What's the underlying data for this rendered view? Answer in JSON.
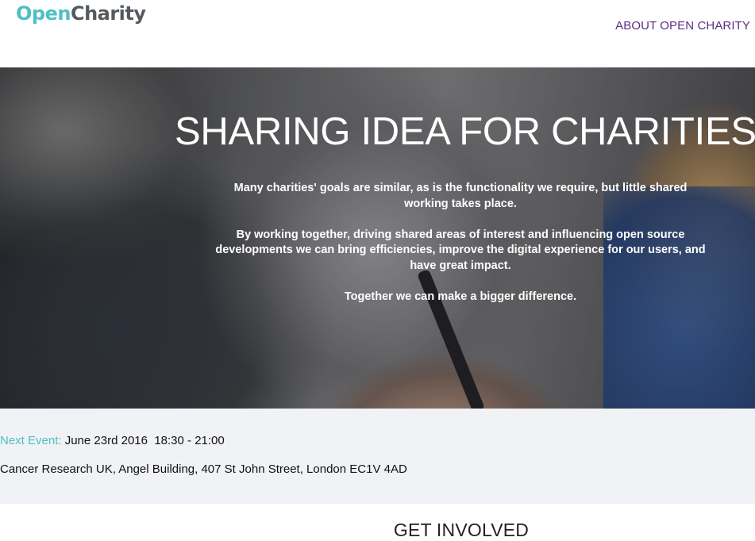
{
  "colors": {
    "teal": "#4ec0c4",
    "grey": "#555a5f",
    "nav": "#5b2d86"
  },
  "logo": {
    "part1": "Open",
    "part2": "Charity"
  },
  "nav": {
    "about": "ABOUT OPEN CHARITY"
  },
  "hero": {
    "title": "SHARING IDEA FOR CHARITIES",
    "paragraphs": [
      "Many charities' goals are similar, as is the functionality we require, but little shared working takes place.",
      "By working together, driving shared areas of interest and influencing open source developments we can bring efficiencies, improve the digital experience for our users, and have great impact.",
      "Together we can make a bigger difference."
    ]
  },
  "event": {
    "label": "Next Event:",
    "date": "June 23rd 2016",
    "time": "18:30 - 21:00",
    "location": "Cancer Research UK, Angel Building, 407 St John Street, London EC1V 4AD"
  },
  "sections": {
    "get_involved": "GET INVOLVED"
  }
}
